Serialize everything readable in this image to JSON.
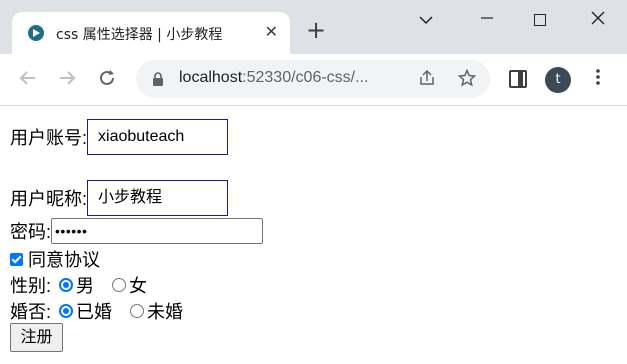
{
  "browser": {
    "tab": {
      "title": "css 属性选择器 | 小步教程",
      "close": "✕"
    },
    "new_tab": "+",
    "window": {
      "chevron": "⌄",
      "minimize": "—",
      "close": "✕"
    },
    "url": {
      "host": "localhost",
      "path": ":52330/c06-css/..."
    },
    "avatar_letter": "t",
    "icons": [
      "back-arrow-icon",
      "forward-arrow-icon",
      "reload-icon",
      "lock-icon",
      "share-icon",
      "star-icon",
      "side-panel-icon",
      "more-menu-icon"
    ]
  },
  "form": {
    "account_label": "用户账号:",
    "account_value": "xiaobuteach",
    "nickname_label": "用户昵称:",
    "nickname_value": "小步教程",
    "password_label": "密码:",
    "password_value": "••••••",
    "agree_label": "同意协议",
    "agree_checked": true,
    "gender_label": "性别:",
    "gender_options": [
      "男",
      "女"
    ],
    "gender_selected": "男",
    "married_label": "婚否:",
    "married_options": [
      "已婚",
      "未婚"
    ],
    "married_selected": "已婚",
    "submit_label": "注册"
  },
  "colors": {
    "accent": "#0075ff",
    "input_border": "#1a1a8c",
    "tab_strip": "#dee1e6"
  }
}
